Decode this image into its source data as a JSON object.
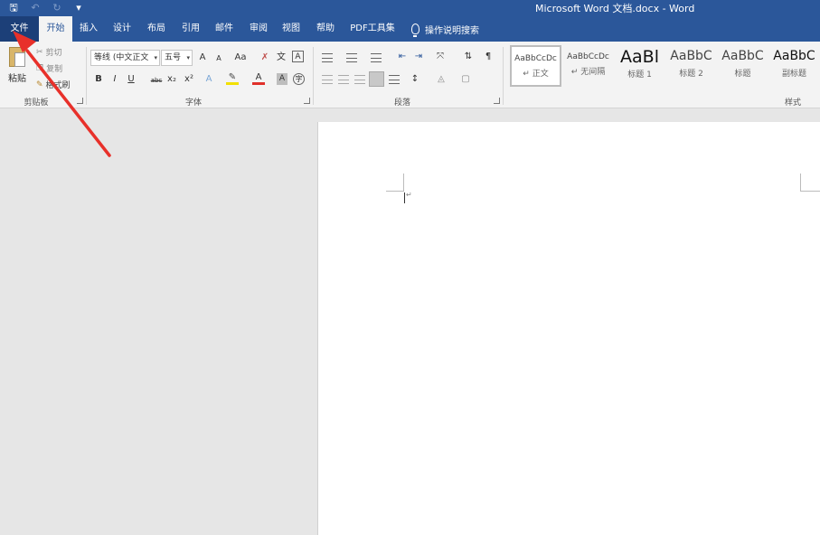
{
  "window": {
    "title": "Microsoft Word 文档.docx  -  Word",
    "qat": {
      "save": "🖫",
      "undo": "↶",
      "redo": "↻",
      "customize": "▾"
    }
  },
  "tabs": [
    {
      "label": "文件",
      "id": "file"
    },
    {
      "label": "开始",
      "id": "home",
      "active": true
    },
    {
      "label": "插入",
      "id": "insert"
    },
    {
      "label": "设计",
      "id": "design"
    },
    {
      "label": "布局",
      "id": "layout"
    },
    {
      "label": "引用",
      "id": "references"
    },
    {
      "label": "邮件",
      "id": "mailings"
    },
    {
      "label": "审阅",
      "id": "review"
    },
    {
      "label": "视图",
      "id": "view"
    },
    {
      "label": "帮助",
      "id": "help"
    },
    {
      "label": "PDF工具集",
      "id": "pdf"
    }
  ],
  "tell_me": "操作说明搜索",
  "clipboard": {
    "paste": "粘贴",
    "cut": "剪切",
    "copy": "复制",
    "format_painter": "格式刷",
    "group": "剪贴板"
  },
  "font": {
    "name": "等线 (中文正文",
    "size": "五号",
    "group": "字体",
    "grow": "A",
    "shrink": "A",
    "case": "Aa",
    "bold": "B",
    "italic": "I",
    "underline": "U",
    "strike": "abc",
    "sub": "x₂",
    "sup": "x²",
    "color": "A",
    "char_shade": "A",
    "enclose": "字"
  },
  "paragraph": {
    "group": "段落"
  },
  "styles": {
    "group": "样式",
    "items": [
      {
        "sample": "AaBbCcDc",
        "name": "↵ 正文"
      },
      {
        "sample": "AaBbCcDc",
        "name": "↵ 无间隔"
      },
      {
        "sample": "AaBl",
        "name": "标题 1"
      },
      {
        "sample": "AaBbC",
        "name": "标题 2"
      },
      {
        "sample": "AaBbC",
        "name": "标题"
      },
      {
        "sample": "AaBbC",
        "name": "副标题"
      }
    ]
  },
  "colors": {
    "brand": "#2b579a",
    "file_tab": "#1c3f78",
    "arrow": "#e8302a"
  }
}
